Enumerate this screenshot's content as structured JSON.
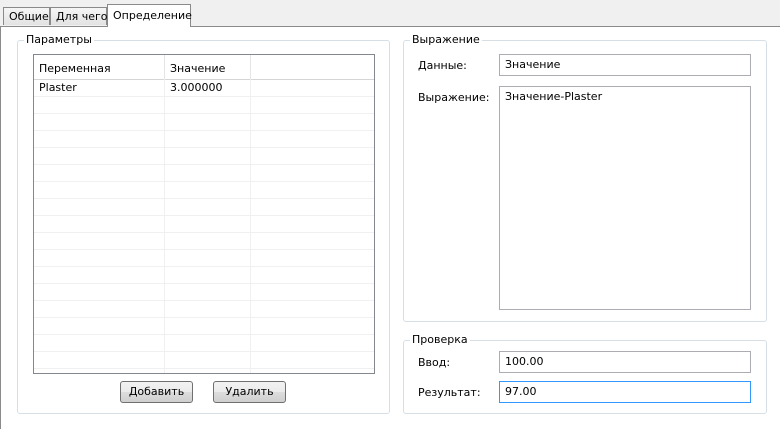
{
  "tabs": [
    {
      "label": "Общие"
    },
    {
      "label": "Для чего"
    },
    {
      "label": "Определение"
    }
  ],
  "params": {
    "title": "Параметры",
    "columns": [
      "Переменная",
      "Значение"
    ],
    "rows": [
      {
        "variable": "Plaster",
        "value": "3.000000"
      }
    ],
    "add_label": "Добавить",
    "delete_label": "Удалить"
  },
  "expression": {
    "title": "Выражение",
    "data_label": "Данные:",
    "data_value": "Значение",
    "expr_label": "Выражение:",
    "expr_value": "Значение-Plaster"
  },
  "check": {
    "title": "Проверка",
    "input_label": "Ввод:",
    "input_value": "100.00",
    "result_label": "Результат:",
    "result_value": "97.00"
  }
}
